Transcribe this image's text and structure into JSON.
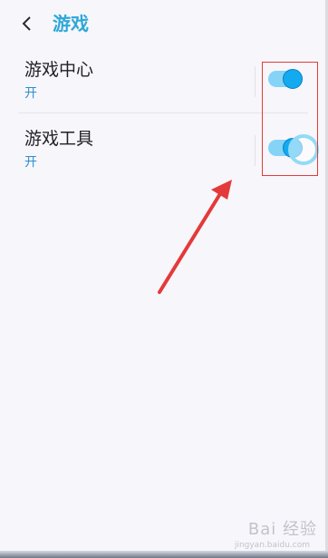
{
  "header": {
    "back_icon": "chevron-left-icon",
    "title": "游戏"
  },
  "settings": [
    {
      "title": "游戏中心",
      "status": "开",
      "enabled": true
    },
    {
      "title": "游戏工具",
      "status": "开",
      "enabled": true
    }
  ],
  "watermark": {
    "logo": "Bai 经验",
    "url": "jingyan.baidu.com"
  },
  "colors": {
    "accent": "#2ea8d8",
    "toggle_on": "#14aaf0",
    "annotation": "#e33a3a"
  }
}
